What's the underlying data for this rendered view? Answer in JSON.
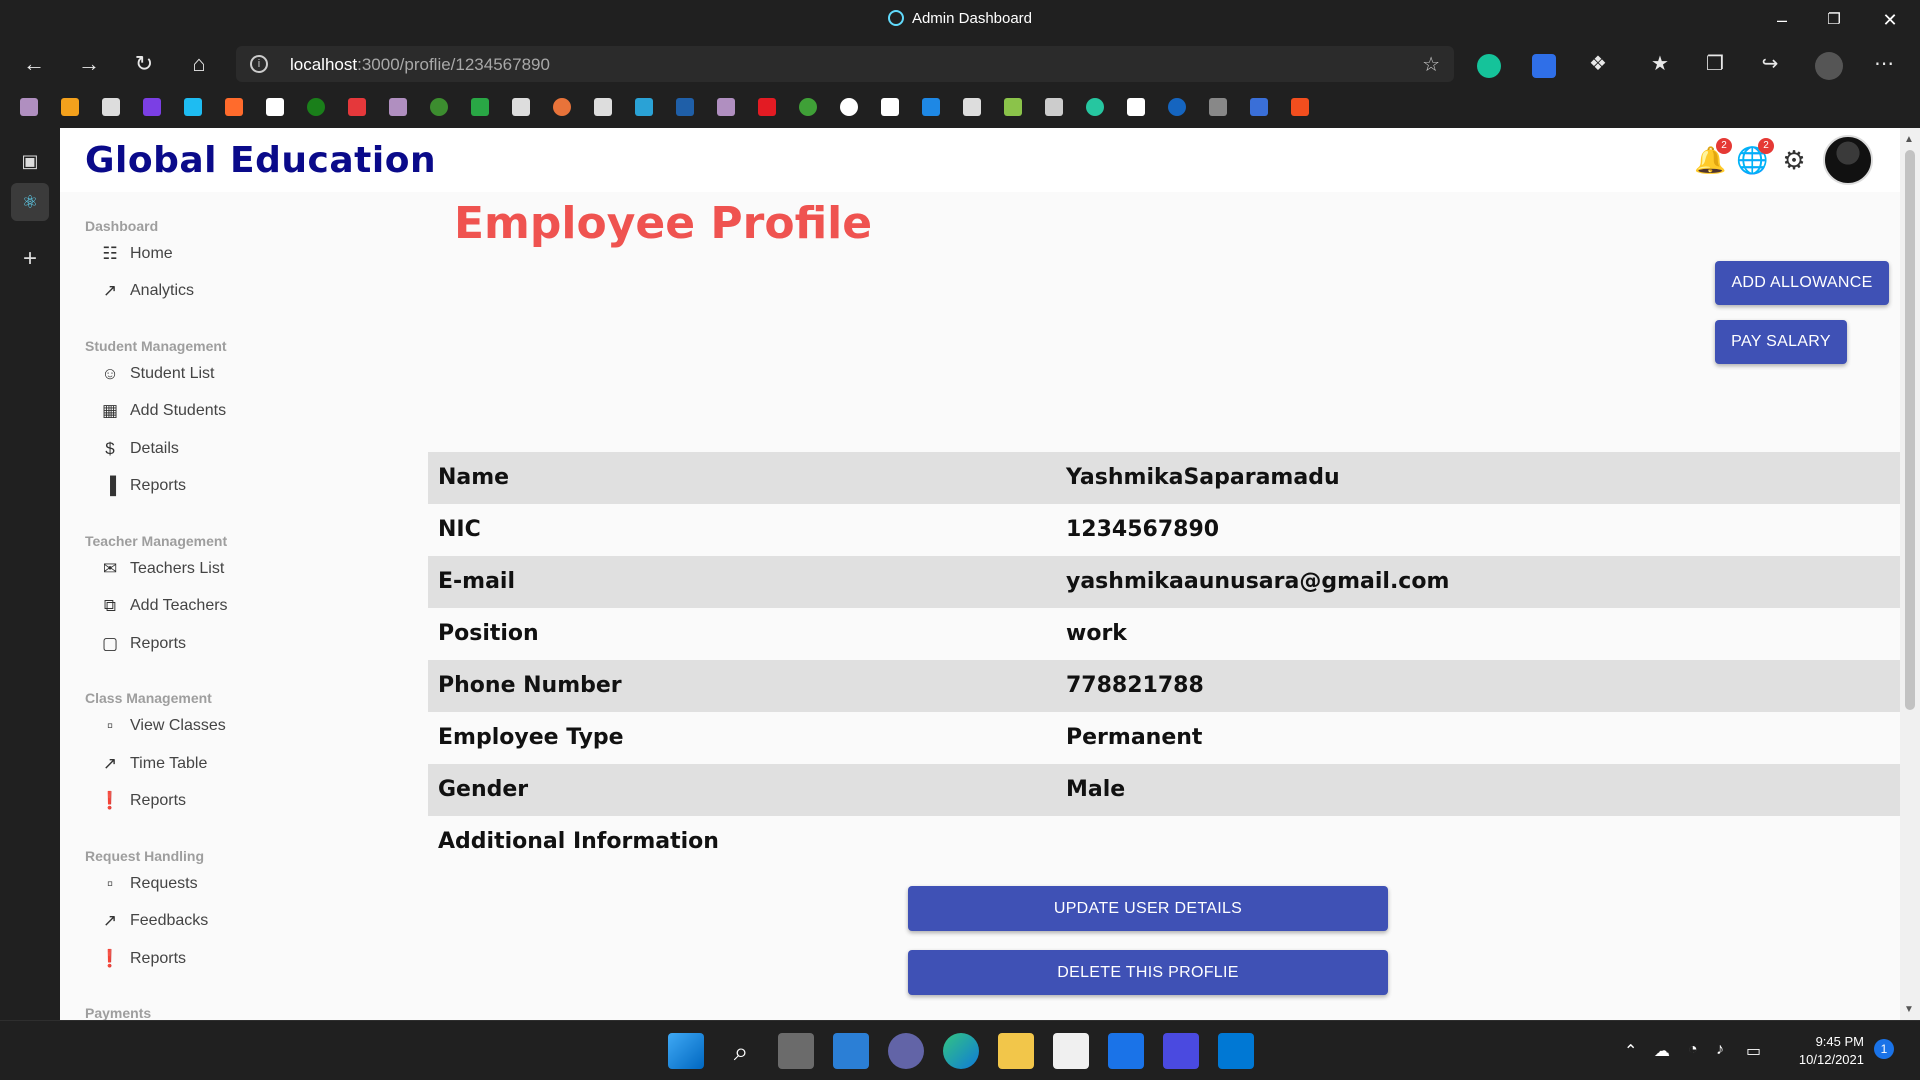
{
  "window": {
    "title": "Admin Dashboard"
  },
  "browser": {
    "url_host": "localhost",
    "url_path": ":3000/proflie/1234567890"
  },
  "app": {
    "brand": "Global Education",
    "notifications_count": "2",
    "language_count": "2"
  },
  "sidebar": {
    "sections": [
      {
        "title": "Dashboard",
        "items": [
          {
            "label": "Home",
            "icon": "view-quilt-icon"
          },
          {
            "label": "Analytics",
            "icon": "timeline-icon"
          }
        ]
      },
      {
        "title": "Student Management",
        "items": [
          {
            "label": "Student List",
            "icon": "person-outline-icon"
          },
          {
            "label": "Add Students",
            "icon": "storefront-icon"
          },
          {
            "label": "Details",
            "icon": "dollar-icon"
          },
          {
            "label": "Reports",
            "icon": "bar-chart-icon"
          }
        ]
      },
      {
        "title": "Teacher Management",
        "items": [
          {
            "label": "Teachers List",
            "icon": "mail-outline-icon"
          },
          {
            "label": "Add Teachers",
            "icon": "dynamic-feed-icon"
          },
          {
            "label": "Reports",
            "icon": "chat-bubble-outline-icon"
          }
        ]
      },
      {
        "title": "Class Management",
        "items": [
          {
            "label": "View Classes",
            "icon": "work-outline-icon"
          },
          {
            "label": "Time Table",
            "icon": "timeline-icon"
          },
          {
            "label": "Reports",
            "icon": "report-icon"
          }
        ]
      },
      {
        "title": "Request Handling",
        "items": [
          {
            "label": "Requests",
            "icon": "work-outline-icon"
          },
          {
            "label": "Feedbacks",
            "icon": "timeline-icon"
          },
          {
            "label": "Reports",
            "icon": "report-icon"
          }
        ]
      },
      {
        "title": "Payments",
        "items": []
      }
    ]
  },
  "main": {
    "title": "Employee Profile",
    "add_allowance": "ADD ALLOWANCE",
    "pay_salary": "PAY SALARY",
    "rows": [
      {
        "key": "Name",
        "value": "YashmikaSaparamadu"
      },
      {
        "key": "NIC",
        "value": "1234567890"
      },
      {
        "key": "E-mail",
        "value": "yashmikaaunusara@gmail.com"
      },
      {
        "key": "Position",
        "value": "work"
      },
      {
        "key": "Phone Number",
        "value": "778821788"
      },
      {
        "key": "Employee Type",
        "value": "Permanent"
      },
      {
        "key": "Gender",
        "value": "Male"
      },
      {
        "key": "Additional Information",
        "value": ""
      }
    ],
    "update_button": "UPDATE USER DETAILS",
    "delete_button": "DELETE THIS PROFLIE"
  },
  "taskbar": {
    "time": "9:45 PM",
    "date": "10/12/2021",
    "notification_count": "1"
  },
  "colors": {
    "brand": "#0a0a8a",
    "title": "#ef5350",
    "primary_button": "#3f51b5",
    "row_shade": "#e0e0e0"
  }
}
